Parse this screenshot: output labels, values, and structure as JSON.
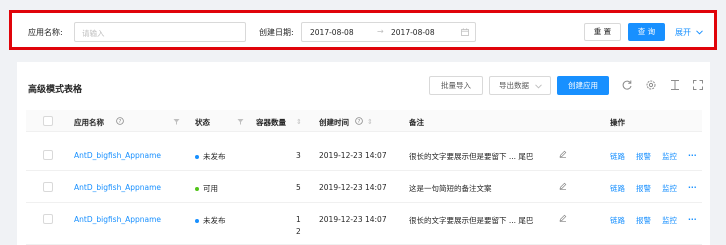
{
  "search": {
    "app_name_label": "应用名称:",
    "app_name_placeholder": "请输入",
    "date_label": "创建日期:",
    "date_start": "2017-08-08",
    "date_sep": "→",
    "date_end": "2017-08-08",
    "reset_label": "重 置",
    "query_label": "查 询",
    "expand_label": "展开"
  },
  "card": {
    "title": "高级模式表格",
    "batch_import": "批量导入",
    "export_data": "导出数据",
    "create_app": "创建应用"
  },
  "table": {
    "columns": [
      "应用名称",
      "状态",
      "容器数量",
      "创建时间",
      "备注",
      "操作"
    ],
    "rows": [
      {
        "name": "AntD_bigfish_Appname",
        "status": "未发布",
        "status_color": "#1890ff",
        "count": "3",
        "count_extra": "",
        "created": "2019-12-23 14:07",
        "note": "很长的文字要展示但是要留下 ... 尾巴",
        "actions": [
          "链路",
          "报警",
          "监控",
          "···"
        ]
      },
      {
        "name": "AntD_bigfish_Appname",
        "status": "可用",
        "status_color": "#52c41a",
        "count": "5",
        "count_extra": "",
        "created": "2019-12-23 14:07",
        "note": "这是一句简短的备注文案",
        "actions": [
          "链路",
          "报警",
          "监控",
          "···"
        ]
      },
      {
        "name": "AntD_bigfish_Appname",
        "status": "未发布",
        "status_color": "#1890ff",
        "count": "1",
        "count_extra": "2",
        "created": "2019-12-23 14:07",
        "note": "很长的文字要展示但是要留下 ... 尾巴",
        "actions": [
          "链路",
          "报警",
          "监控",
          "···"
        ]
      }
    ]
  },
  "colors": {
    "accent": "#1890ff",
    "highlight_border": "#e0040a",
    "status_available": "#52c41a"
  },
  "icons": [
    "calendar-icon",
    "chevron-down-icon",
    "help-icon",
    "filter-icon",
    "sort-icon",
    "reload-icon",
    "settings-icon",
    "column-height-icon",
    "fullscreen-icon",
    "edit-icon"
  ]
}
